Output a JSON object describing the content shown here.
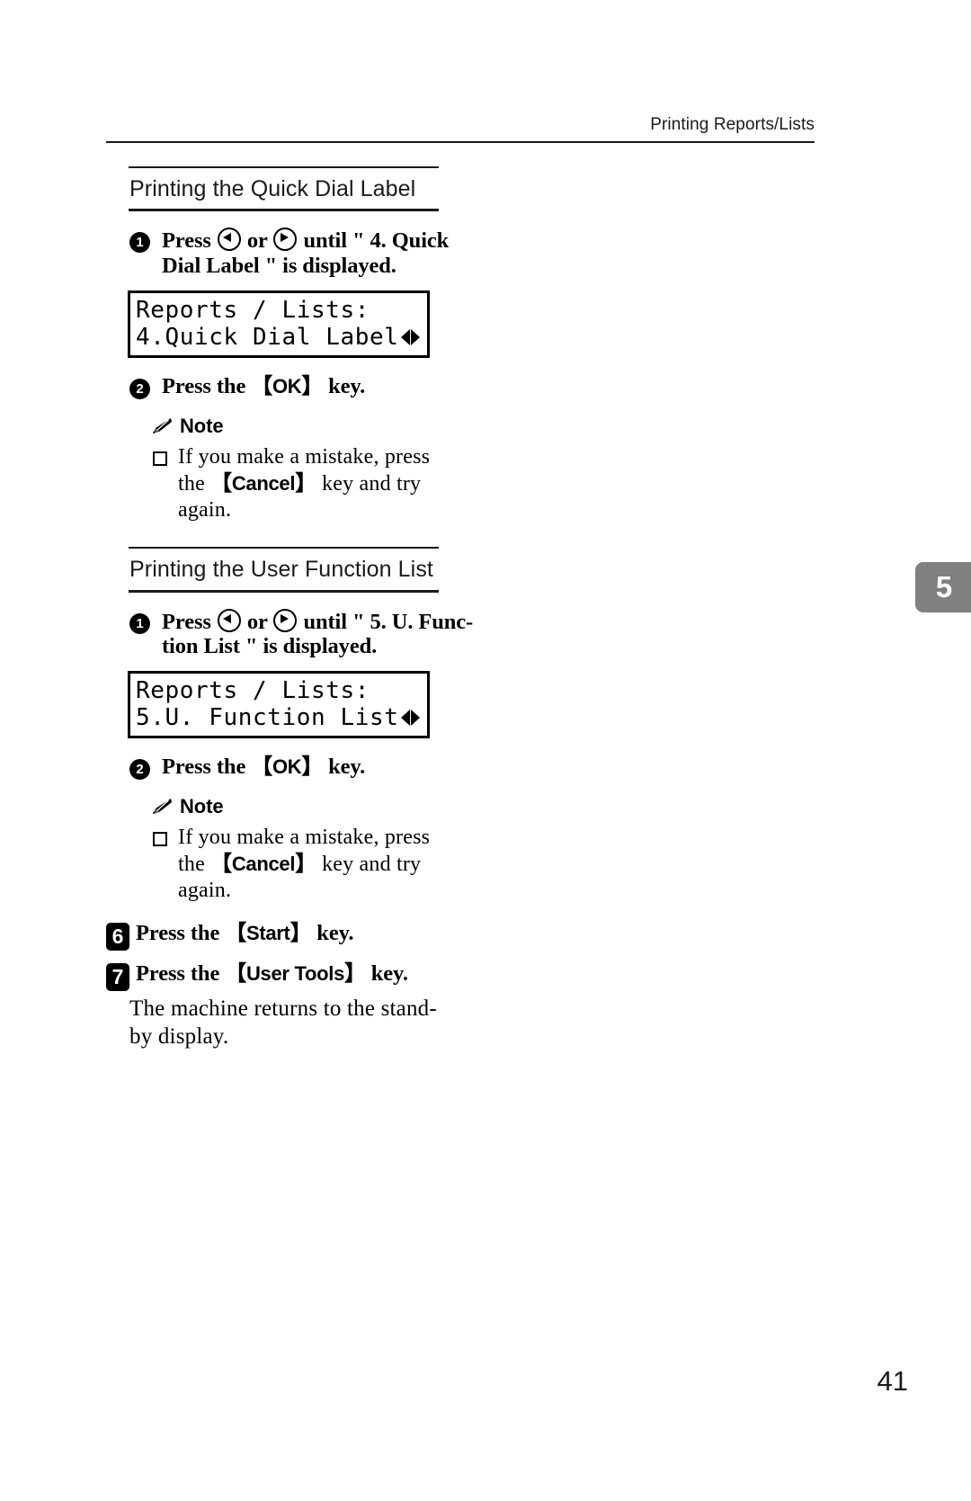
{
  "header": {
    "running_title": "Printing Reports/Lists"
  },
  "chapter_tab": {
    "number": "5",
    "color": "#808080"
  },
  "sections": [
    {
      "title": "Printing the Quick Dial Label",
      "steps": [
        {
          "badge": "1",
          "badge_style": "circle",
          "line1_pre": "Press ",
          "line1_mid": " or ",
          "line1_post": " until \" 4. Quick",
          "line2": "Dial Label \" is displayed."
        },
        {
          "badge": "2",
          "badge_style": "circle",
          "text_pre": "Press the ",
          "key": "OK",
          "text_post": " key."
        }
      ],
      "lcd": {
        "line1": "Reports / Lists:",
        "line2": "4.Quick Dial Label"
      },
      "note": {
        "label": "Note",
        "icon": "pencil-icon",
        "item_line1": "If you make a mistake, press",
        "item_line2_pre": "the ",
        "item_key": "Cancel",
        "item_line2_post": " key and try",
        "item_line3": "again."
      }
    },
    {
      "title": "Printing the User Function List",
      "steps": [
        {
          "badge": "1",
          "badge_style": "circle",
          "line1_pre": "Press ",
          "line1_mid": " or ",
          "line1_post": " until \" 5. U. Func-",
          "line2": "tion List \" is displayed."
        },
        {
          "badge": "2",
          "badge_style": "circle",
          "text_pre": "Press the ",
          "key": "OK",
          "text_post": " key."
        }
      ],
      "lcd": {
        "line1": "Reports / Lists:",
        "line2": "5.U. Function List"
      },
      "note": {
        "label": "Note",
        "icon": "pencil-icon",
        "item_line1": "If you make a mistake, press",
        "item_line2_pre": "the ",
        "item_key": "Cancel",
        "item_line2_post": " key and try",
        "item_line3": "again."
      }
    }
  ],
  "outer_steps": [
    {
      "badge": "6",
      "badge_style": "square",
      "text_pre": "Press the ",
      "key": "Start",
      "text_post": " key."
    },
    {
      "badge": "7",
      "badge_style": "square",
      "text_pre": "Press the ",
      "key": "User Tools",
      "text_post": " key.",
      "body_line1": "The machine returns to the stand-",
      "body_line2": "by display."
    }
  ],
  "page_number": "41",
  "glyphs": {
    "bracket_open": "【",
    "bracket_close": "】",
    "left_arrow_key": "left-arrow-key-icon",
    "right_arrow_key": "right-arrow-key-icon"
  }
}
